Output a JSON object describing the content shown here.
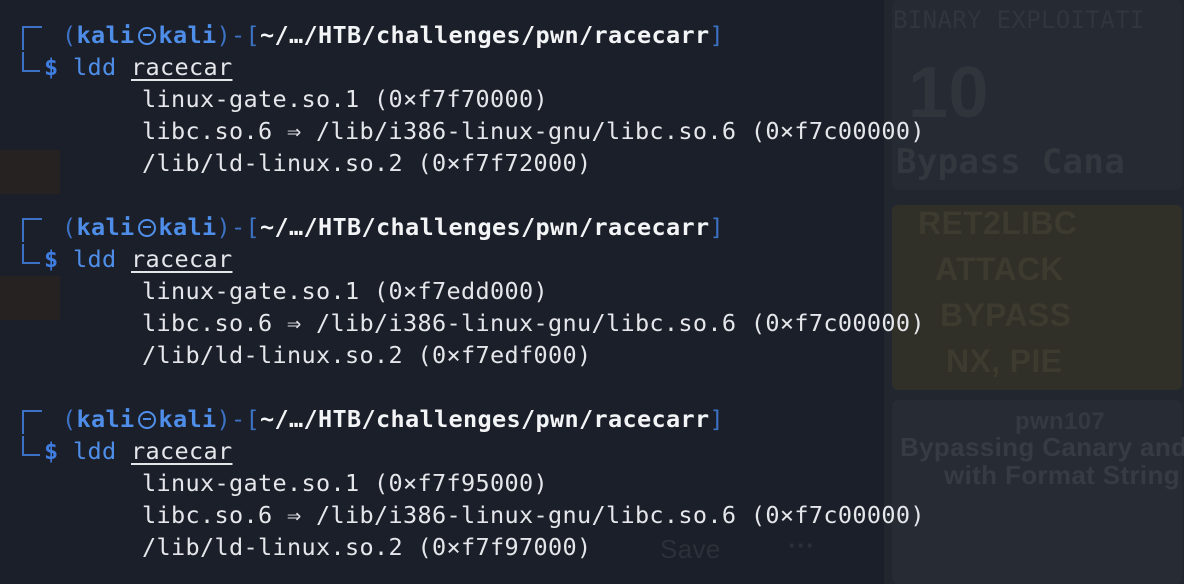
{
  "terminal": {
    "prompt": {
      "user": "kali",
      "host": "kali",
      "path": "~/…/HTB/challenges/pwn/racecarr",
      "symbol": "$"
    },
    "blocks": [
      {
        "command": "ldd",
        "argument": "racecar",
        "output": [
          "linux-gate.so.1 (0×f7f70000)",
          "libc.so.6 ⇒ /lib/i386-linux-gnu/libc.so.6 (0×f7c00000)",
          "/lib/ld-linux.so.2 (0×f7f72000)"
        ]
      },
      {
        "command": "ldd",
        "argument": "racecar",
        "output": [
          "linux-gate.so.1 (0×f7edd000)",
          "libc.so.6 ⇒ /lib/i386-linux-gnu/libc.so.6 (0×f7c00000)",
          "/lib/ld-linux.so.2 (0×f7edf000)"
        ]
      },
      {
        "command": "ldd",
        "argument": "racecar",
        "output": [
          "linux-gate.so.1 (0×f7f95000)",
          "libc.so.6 ⇒ /lib/i386-linux-gnu/libc.so.6 (0×f7c00000)",
          "/lib/ld-linux.so.2 (0×f7f97000)"
        ]
      }
    ]
  },
  "background": {
    "thumb1_title": "BINARY EXPLOITATI",
    "thumb1_number": "10",
    "thumb1_sub": "Bypass Cana",
    "thumb2_lines": [
      "RET2LIBC",
      "ATTACK",
      "BYPASS",
      "NX, PIE"
    ],
    "thumb3_top": "pwn107",
    "thumb3_title": "Bypassing Canary and P",
    "thumb3_sub": "with Format String",
    "save_label": "Save",
    "dots": "···"
  },
  "colors": {
    "background": "#1b1f2a",
    "prompt_bracket": "#3c72c4",
    "user": "#4f8ee8",
    "text": "#e4e6ea"
  }
}
